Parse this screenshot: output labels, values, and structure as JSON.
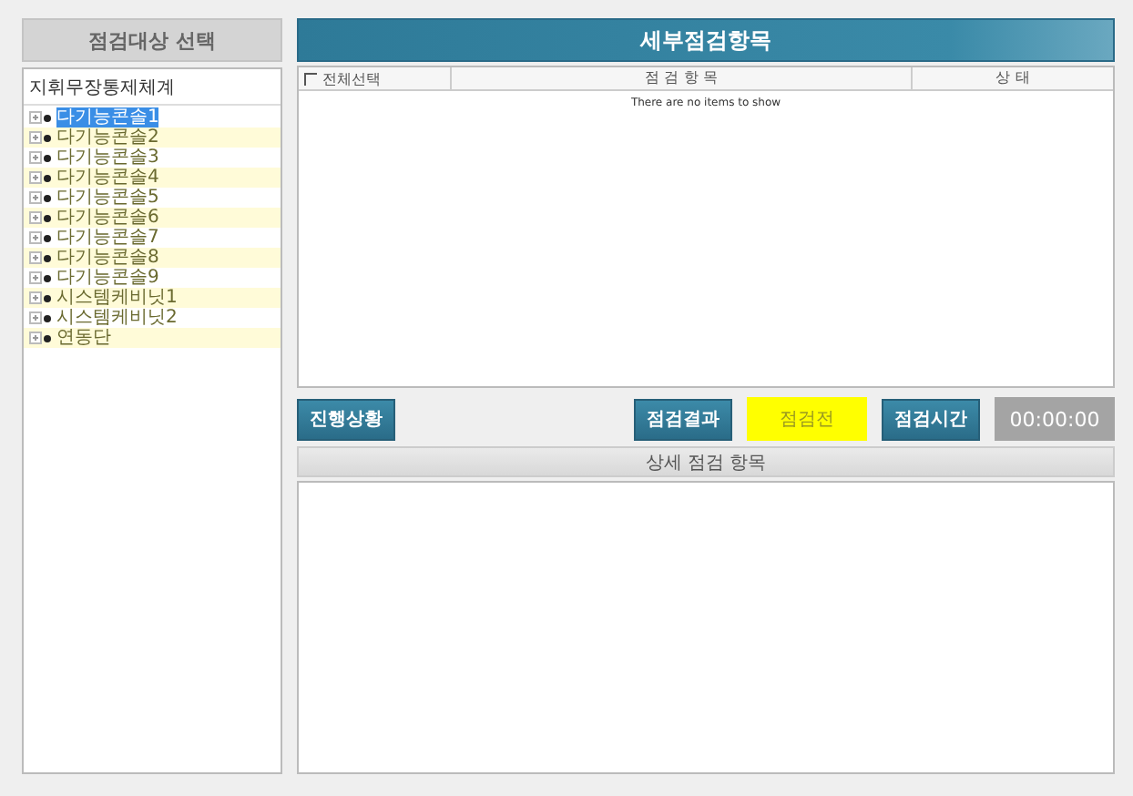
{
  "left_panel": {
    "title": "점검대상 선택",
    "tree_root": "지휘무장통제체계",
    "items": [
      {
        "label": "다기능콘솔1",
        "selected": true,
        "highlighted": false
      },
      {
        "label": "다기능콘솔2",
        "selected": false,
        "highlighted": true
      },
      {
        "label": "다기능콘솔3",
        "selected": false,
        "highlighted": false
      },
      {
        "label": "다기능콘솔4",
        "selected": false,
        "highlighted": true
      },
      {
        "label": "다기능콘솔5",
        "selected": false,
        "highlighted": false
      },
      {
        "label": "다기능콘솔6",
        "selected": false,
        "highlighted": true
      },
      {
        "label": "다기능콘솔7",
        "selected": false,
        "highlighted": false
      },
      {
        "label": "다기능콘솔8",
        "selected": false,
        "highlighted": true
      },
      {
        "label": "다기능콘솔9",
        "selected": false,
        "highlighted": false
      },
      {
        "label": "시스템케비닛1",
        "selected": false,
        "highlighted": true
      },
      {
        "label": "시스템케비닛2",
        "selected": false,
        "highlighted": false
      },
      {
        "label": "연동단",
        "selected": false,
        "highlighted": true
      }
    ]
  },
  "detail_panel": {
    "title": "세부점검항목",
    "select_all": {
      "label": "전체선택",
      "checked": false
    },
    "columns": [
      "점 검 항 목",
      "상 태"
    ],
    "empty_text": "There are no items to show"
  },
  "toolbar": {
    "progress_button": "진행상황",
    "result_button": "점검결과",
    "result_value": "점검전",
    "time_button": "점검시간",
    "time_value": "00:00:00"
  },
  "sub_panel": {
    "title": "상세 점검 항목"
  }
}
